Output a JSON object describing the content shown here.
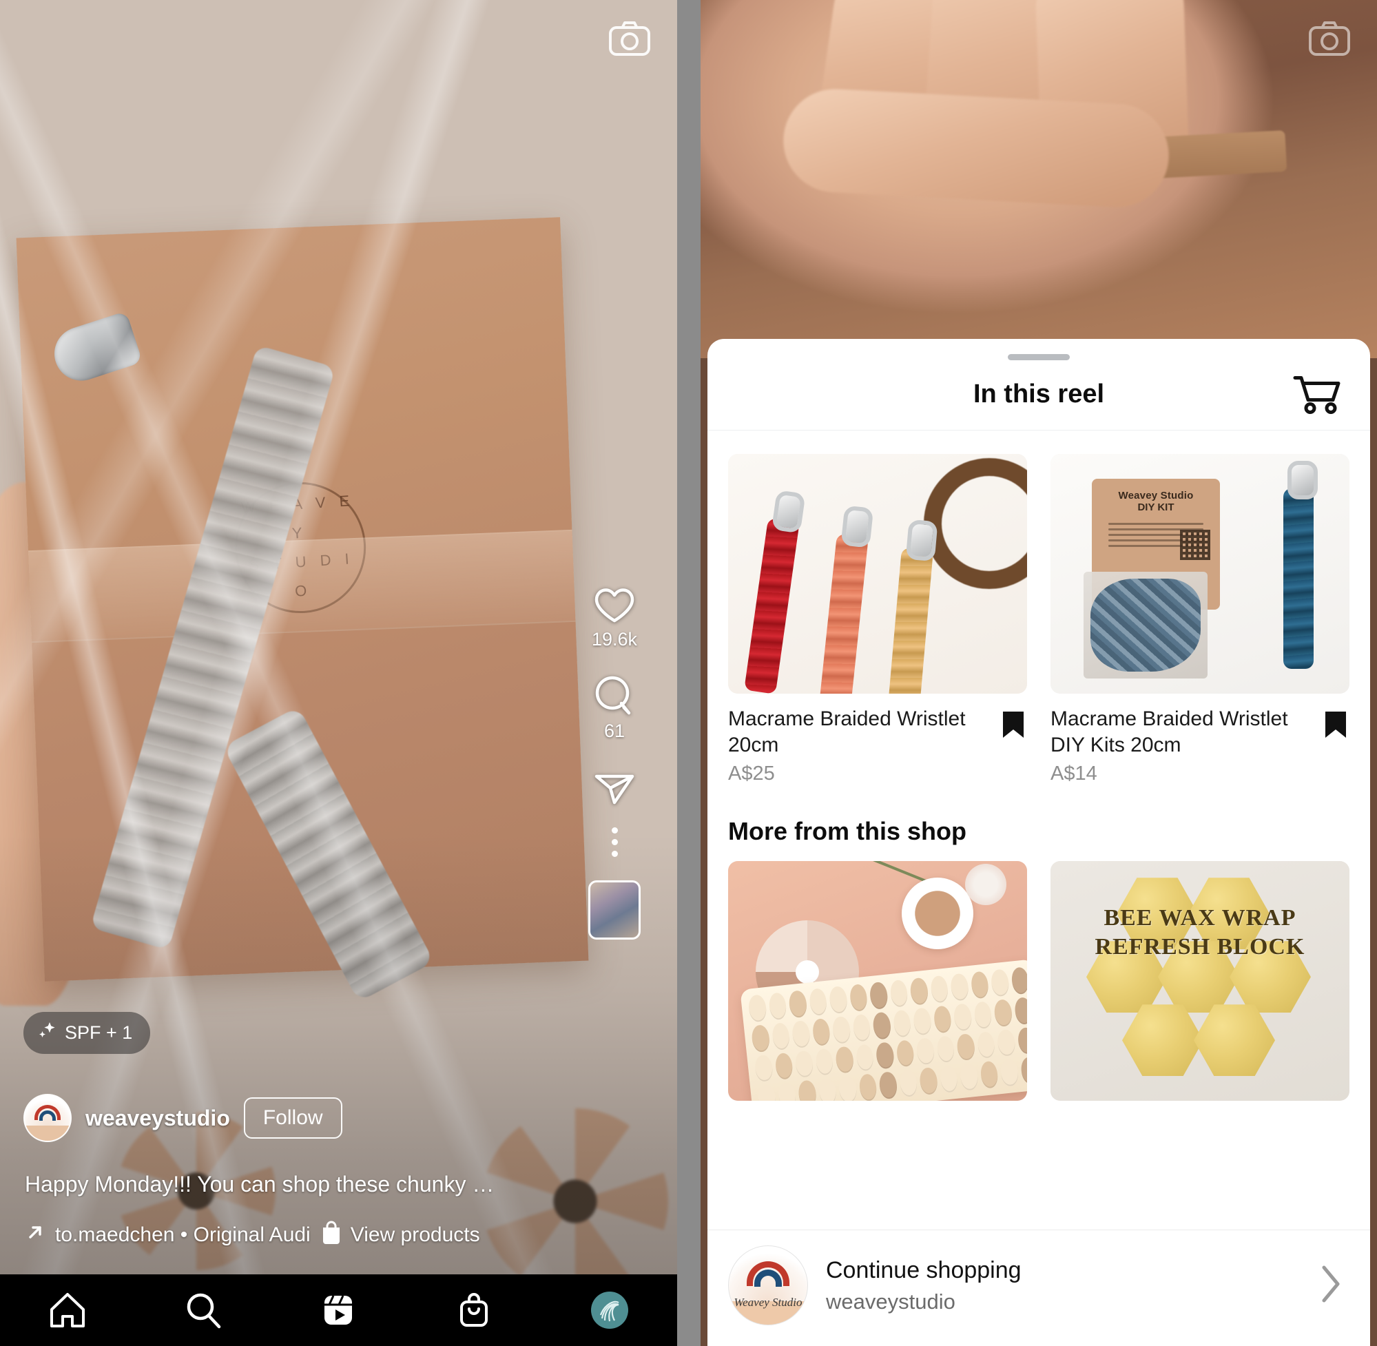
{
  "reel": {
    "camera_icon": "camera-icon",
    "effect_badge": {
      "icon": "sparkles-icon",
      "label": "SPF + 1"
    },
    "account": {
      "username": "weaveystudio",
      "follow_label": "Follow",
      "avatar": "profile-avatar"
    },
    "caption": "Happy Monday!!! You can shop these chunky …",
    "audio": {
      "icon": "audio-arrow-icon",
      "text": "to.maedchen • Original Audi"
    },
    "view_products": {
      "icon": "shopping-bag-icon",
      "label": "View products"
    },
    "actions": {
      "like": {
        "icon": "heart-icon",
        "count": "19.6k"
      },
      "comment": {
        "icon": "comment-icon",
        "count": "61"
      },
      "share": {
        "icon": "share-paperplane-icon"
      },
      "more": {
        "icon": "more-options-icon"
      },
      "remix_thumb": {
        "icon": "remix-thumbnail"
      }
    },
    "tabbar": [
      {
        "name": "home",
        "icon": "home-icon"
      },
      {
        "name": "search",
        "icon": "search-icon"
      },
      {
        "name": "reels",
        "icon": "reels-icon"
      },
      {
        "name": "shop",
        "icon": "shop-bag-icon"
      },
      {
        "name": "profile",
        "icon": "profile-icon"
      }
    ]
  },
  "shop_sheet": {
    "camera_icon": "camera-icon",
    "title": "In this reel",
    "cart_icon": "shopping-cart-icon",
    "in_this_reel": [
      {
        "title": "Macrame Braided Wristlet 20cm",
        "price": "A$25",
        "save_icon": "bookmark-icon",
        "image": "three-macrame-wristlets-red-coral-mustard"
      },
      {
        "title": "Macrame Braided Wristlet DIY Kits 20cm",
        "price": "A$14",
        "save_icon": "bookmark-icon",
        "image": "diy-kit-blue-wristlet-with-instruction-card",
        "image_text": {
          "brand": "Weavey Studio",
          "kit": "DIY KIT"
        }
      }
    ],
    "more_section_title": "More from this shop",
    "more_from_shop": [
      {
        "image": "desk-flatlay-keyboard-coffee-flowers"
      },
      {
        "image": "bee-wax-wrap-refresh-block-honeycomb",
        "image_text": "BEE WAX WRAP REFRESH BLOCK"
      }
    ],
    "footer": {
      "primary": "Continue shopping",
      "secondary": "weaveystudio",
      "avatar": "shop-avatar",
      "avatar_wordmark": "Weavey Studio",
      "chevron_icon": "chevron-right-icon"
    }
  },
  "package_stamp": {
    "line1": "W E A V E Y",
    "line2": "S T U D I O"
  },
  "colors": {
    "accent_teal": "#4f8f93",
    "sheet_bg": "#ffffff",
    "tabbar_bg": "#000000",
    "price_grey": "#8e8e8e"
  }
}
